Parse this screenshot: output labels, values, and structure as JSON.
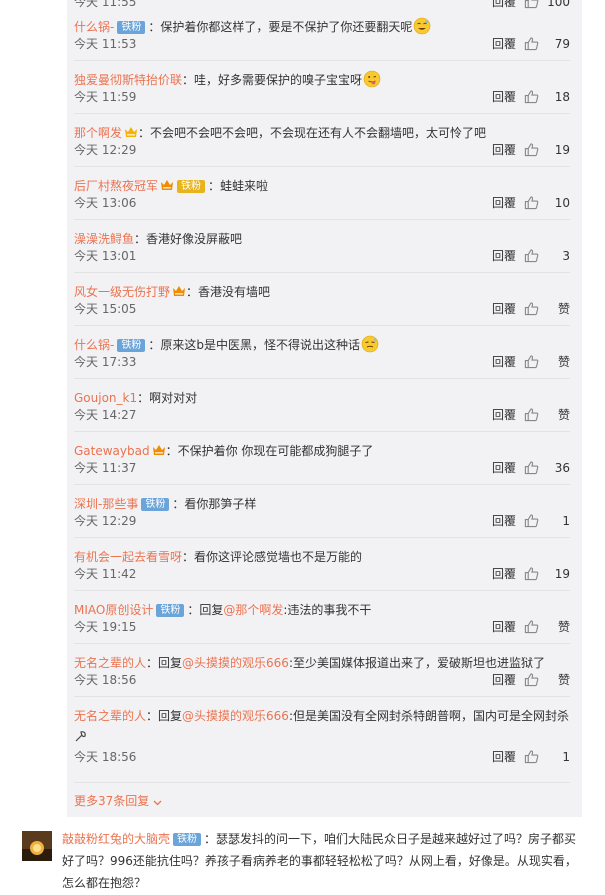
{
  "comments": [
    {
      "user": "什么锅-",
      "badge": "铁粉",
      "crown": false,
      "crown_color": "",
      "text": "：保护着你都这样了，要是不保护了你还要翻天呢",
      "emoji": "wink",
      "time": "今天 11:53",
      "reply": "回覆",
      "likes": "79"
    },
    {
      "user": "独爱曼彻斯特抬价联",
      "badge": "",
      "crown": false,
      "crown_color": "",
      "text": "：哇，好多需要保护的嗅子宝宝呀",
      "emoji": "tongue",
      "time": "今天 11:59",
      "reply": "回覆",
      "likes": "18"
    },
    {
      "user": "那个啊发",
      "badge": "",
      "crown": true,
      "crown_color": "#f5b400",
      "text": "：不会吧不会吧不会吧，不会现在还有人不会翻墙吧，太可怜了吧",
      "emoji": "",
      "time": "今天 12:29",
      "reply": "回覆",
      "likes": "19"
    },
    {
      "user": "后厂村熬夜冠军",
      "badge": "铁粉",
      "crown": true,
      "crown_color": "#f08c00",
      "text": "：蛙蛙来啦",
      "emoji": "",
      "time": "今天 13:06",
      "reply": "回覆",
      "likes": "10"
    },
    {
      "user": "澡澡洗鲟鱼",
      "badge": "",
      "crown": false,
      "crown_color": "",
      "text": "：香港好像没屏蔽吧",
      "emoji": "",
      "time": "今天 13:01",
      "reply": "回覆",
      "likes": "3"
    },
    {
      "user": "风女一级无伤打野",
      "badge": "",
      "crown": true,
      "crown_color": "#f08c00",
      "text": "：香港没有墙吧",
      "emoji": "",
      "time": "今天 15:05",
      "reply": "回覆",
      "likes": "赞"
    },
    {
      "user": "什么锅-",
      "badge": "铁粉",
      "crown": false,
      "crown_color": "",
      "text": "：原来这b是中医黑，怪不得说出这种话",
      "emoji": "sweat",
      "time": "今天 17:33",
      "reply": "回覆",
      "likes": "赞"
    },
    {
      "user": "Goujon_k1",
      "badge": "",
      "crown": false,
      "crown_color": "",
      "text": "：啊对对对",
      "emoji": "",
      "time": "今天 14:27",
      "reply": "回覆",
      "likes": "赞"
    },
    {
      "user": "Gatewaybad",
      "badge": "",
      "crown": true,
      "crown_color": "#f08c00",
      "text": "：不保护着你 你现在可能都成狗腿子了",
      "emoji": "",
      "time": "今天 11:37",
      "reply": "回覆",
      "likes": "36"
    },
    {
      "user": "深圳-那些事",
      "badge": "铁粉",
      "crown": false,
      "crown_color": "",
      "text": "：看你那笋子样",
      "emoji": "",
      "time": "今天 12:29",
      "reply": "回覆",
      "likes": "1"
    },
    {
      "user": "有机会一起去看雪呀",
      "badge": "",
      "crown": false,
      "crown_color": "",
      "text": "：看你这评论感觉墙也不是万能的",
      "emoji": "",
      "time": "今天 11:42",
      "reply": "回覆",
      "likes": "19"
    },
    {
      "user": "MIAO原创设计",
      "badge": "铁粉",
      "crown": false,
      "crown_color": "",
      "text_prefix": "：回复",
      "mention": "@那个啊发",
      "text": ":违法的事我不干",
      "emoji": "",
      "time": "今天 19:15",
      "reply": "回覆",
      "likes": "赞"
    },
    {
      "user": "无名之辈的人",
      "badge": "",
      "crown": false,
      "crown_color": "",
      "text_prefix": "：回复",
      "mention": "@头摸摸的观乐666",
      "text": ":至少美国媒体报道出来了，爱破斯坦也进监狱了",
      "emoji": "",
      "time": "今天 18:56",
      "reply": "回覆",
      "likes": "赞"
    },
    {
      "user": "无名之辈的人",
      "badge": "",
      "crown": false,
      "crown_color": "",
      "text_prefix": "：回复",
      "mention": "@头摸摸的观乐666",
      "text": ":但是美国没有全网封杀特朗普啊，国内可是全网封杀",
      "emoji": "",
      "time": "今天 18:56",
      "reply": "回覆",
      "likes": "1"
    }
  ],
  "more_replies": "更多37条回复",
  "root": {
    "user": "敲敲粉红兔的大脑壳",
    "badge": "铁粉",
    "text": "：瑟瑟发抖的问一下，咱们大陆民众日子是越来越好过了吗？房子都买好了吗？996还能抗住吗？养孩子看病养老的事都轻轻松松了吗？从网上看，好像是。从现实看，怎么都在抱怨？"
  },
  "top_partial": {
    "time": "今天 11:55",
    "reply": "回覆",
    "likes": "100"
  },
  "colors": {
    "accent": "#eb7350",
    "badge": "#6ba4d9",
    "panel": "#f2f2f5"
  }
}
